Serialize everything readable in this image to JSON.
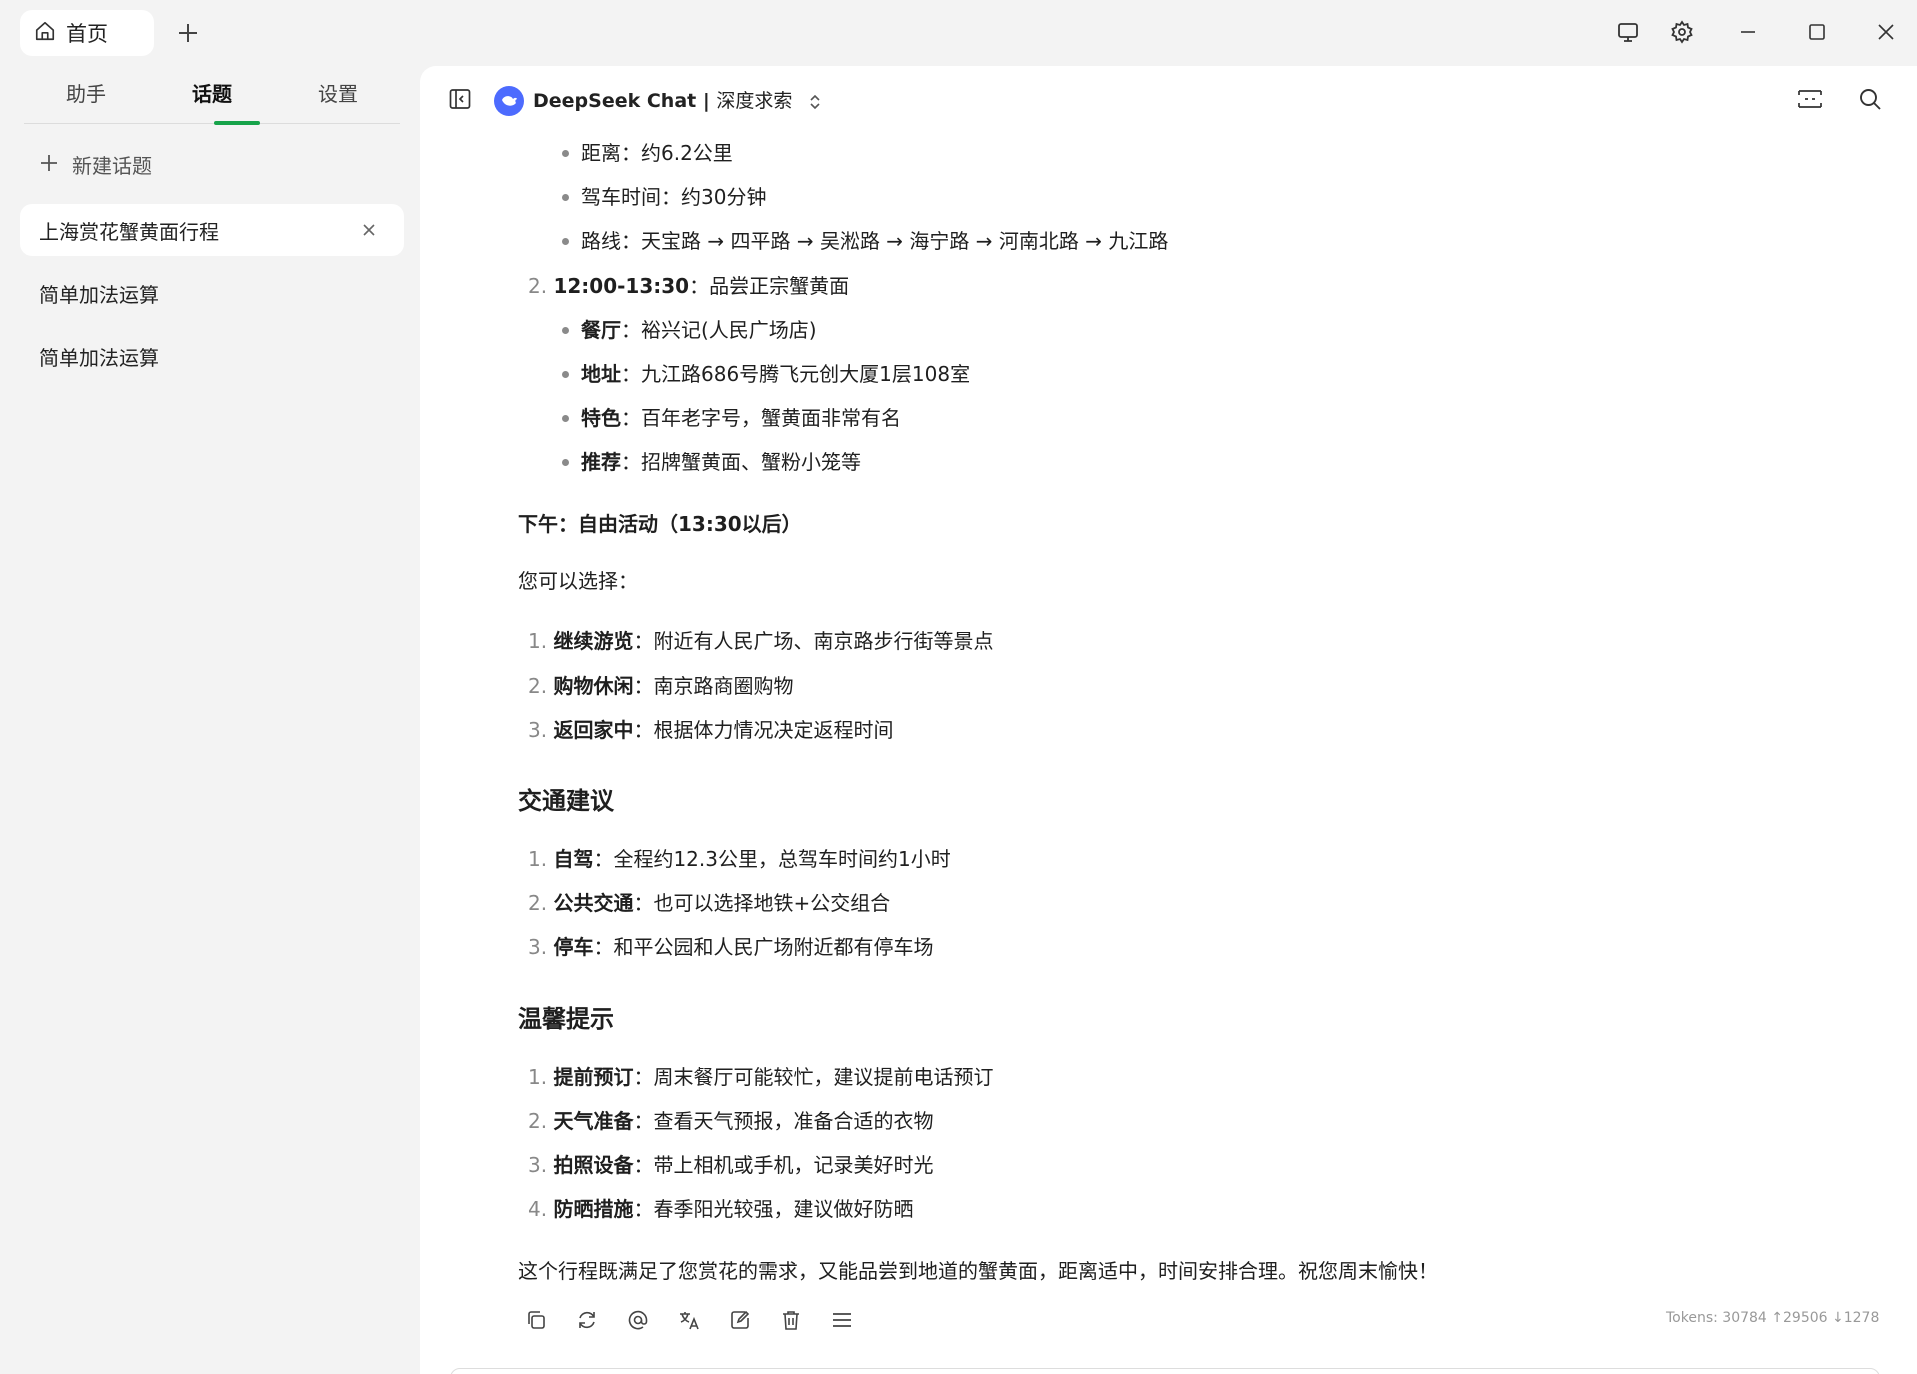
{
  "titlebar": {
    "home_tab_label": "首页",
    "icons": [
      "home-icon",
      "add-tab-icon",
      "monitor-icon",
      "settings-icon",
      "minimize-icon",
      "maximize-icon",
      "close-icon"
    ]
  },
  "sidebar": {
    "tabs": [
      {
        "label": "助手",
        "active": false
      },
      {
        "label": "话题",
        "active": true
      },
      {
        "label": "设置",
        "active": false
      }
    ],
    "new_topic_label": "新建话题",
    "topics": [
      {
        "label": "上海赏花蟹黄面行程",
        "active": true
      },
      {
        "label": "简单加法运算",
        "active": false
      },
      {
        "label": "简单加法运算",
        "active": false
      }
    ]
  },
  "header": {
    "model_name": "DeepSeek Chat",
    "model_sep": " | ",
    "model_provider": "深度求索"
  },
  "message": {
    "route_bullets": [
      {
        "text": "距离：约6.2公里"
      },
      {
        "text": "驾车时间：约30分钟"
      },
      {
        "text": "路线：天宝路 → 四平路 → 吴淞路 → 海宁路 → 河南北路 → 九江路"
      }
    ],
    "lunch": {
      "num": "2.",
      "time": "12:00-13:30",
      "desc": "：品尝正宗蟹黄面",
      "bullets": [
        {
          "key": "餐厅",
          "value": "：裕兴记(人民广场店)"
        },
        {
          "key": "地址",
          "value": "：九江路686号腾飞元创大厦1层108室"
        },
        {
          "key": "特色",
          "value": "：百年老字号，蟹黄面非常有名"
        },
        {
          "key": "推荐",
          "value": "：招牌蟹黄面、蟹粉小笼等"
        }
      ]
    },
    "afternoon_heading": "下午：自由活动（13:30以后）",
    "afternoon_intro": "您可以选择：",
    "afternoon_items": [
      {
        "num": "1.",
        "key": "继续游览",
        "value": "：附近有人民广场、南京路步行街等景点"
      },
      {
        "num": "2.",
        "key": "购物休闲",
        "value": "：南京路商圈购物"
      },
      {
        "num": "3.",
        "key": "返回家中",
        "value": "：根据体力情况决定返程时间"
      }
    ],
    "traffic_heading": "交通建议",
    "traffic_items": [
      {
        "num": "1.",
        "key": "自驾",
        "value": "：全程约12.3公里，总驾车时间约1小时"
      },
      {
        "num": "2.",
        "key": "公共交通",
        "value": "：也可以选择地铁+公交组合"
      },
      {
        "num": "3.",
        "key": "停车",
        "value": "：和平公园和人民广场附近都有停车场"
      }
    ],
    "tips_heading": "温馨提示",
    "tips_items": [
      {
        "num": "1.",
        "key": "提前预订",
        "value": "：周末餐厅可能较忙，建议提前电话预订"
      },
      {
        "num": "2.",
        "key": "天气准备",
        "value": "：查看天气预报，准备合适的衣物"
      },
      {
        "num": "3.",
        "key": "拍照设备",
        "value": "：带上相机或手机，记录美好时光"
      },
      {
        "num": "4.",
        "key": "防晒措施",
        "value": "：春季阳光较强，建议做好防晒"
      }
    ],
    "closing": "这个行程既满足了您赏花的需求，又能品尝到地道的蟹黄面，距离适中，时间安排合理。祝您周末愉快！"
  },
  "actions": [
    "copy-icon",
    "regenerate-icon",
    "mention-icon",
    "translate-icon",
    "edit-icon",
    "delete-icon",
    "more-menu-icon"
  ],
  "tokens": "Tokens: 30784 ↑29506 ↓1278",
  "colors": {
    "accent": "#16a34a",
    "deepseek": "#4d6bfe"
  }
}
